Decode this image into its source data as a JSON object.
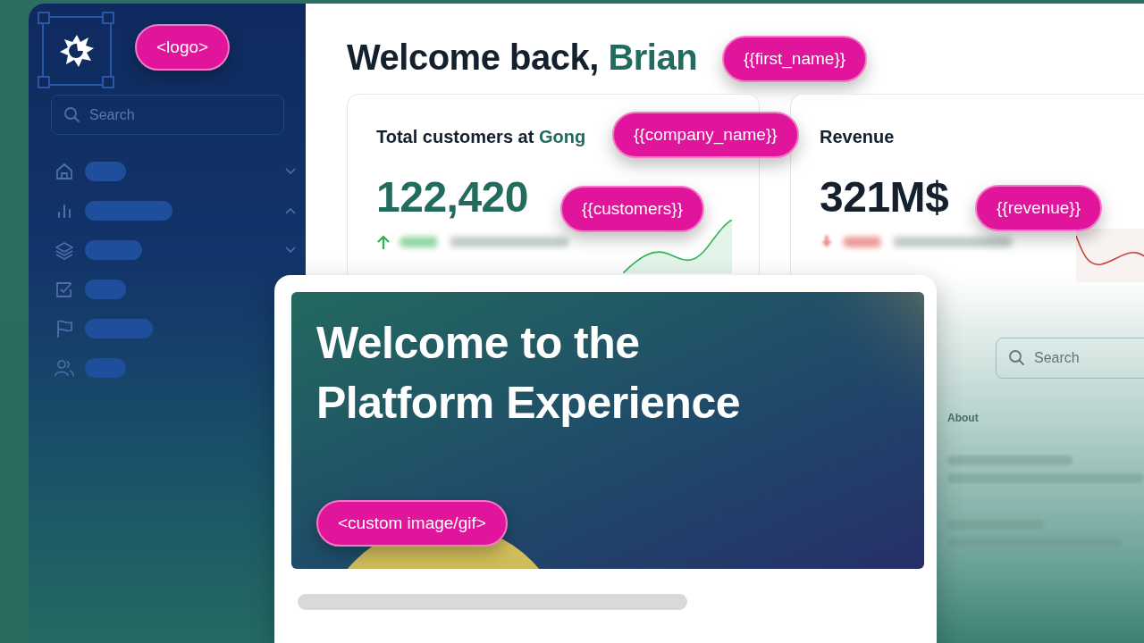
{
  "sidebar": {
    "logo_tag": "<logo>",
    "search": {
      "placeholder": "Search"
    },
    "items": [
      {
        "kind": "home",
        "expanded": false
      },
      {
        "kind": "chart",
        "expanded": true
      },
      {
        "kind": "layers",
        "expanded": false
      },
      {
        "kind": "check"
      },
      {
        "kind": "flag"
      },
      {
        "kind": "users"
      }
    ]
  },
  "header": {
    "greeting": "Welcome back,",
    "name": "Brian",
    "name_tag": "{{first_name}}"
  },
  "cards": [
    {
      "title": "Total customers at",
      "company": "Gong",
      "title_tag": "{{company_name}}",
      "value": "122,420",
      "value_tag": "{{customers}}",
      "rising": true
    },
    {
      "title": "Revenue",
      "value": "321M$",
      "value_tag": "{{revenue}}",
      "rising": false
    }
  ],
  "table": {
    "search": {
      "placeholder": "Search"
    },
    "column": "About"
  },
  "modal": {
    "title": "Welcome to the Platform Experience",
    "image_tag": "<custom image/gif>"
  }
}
